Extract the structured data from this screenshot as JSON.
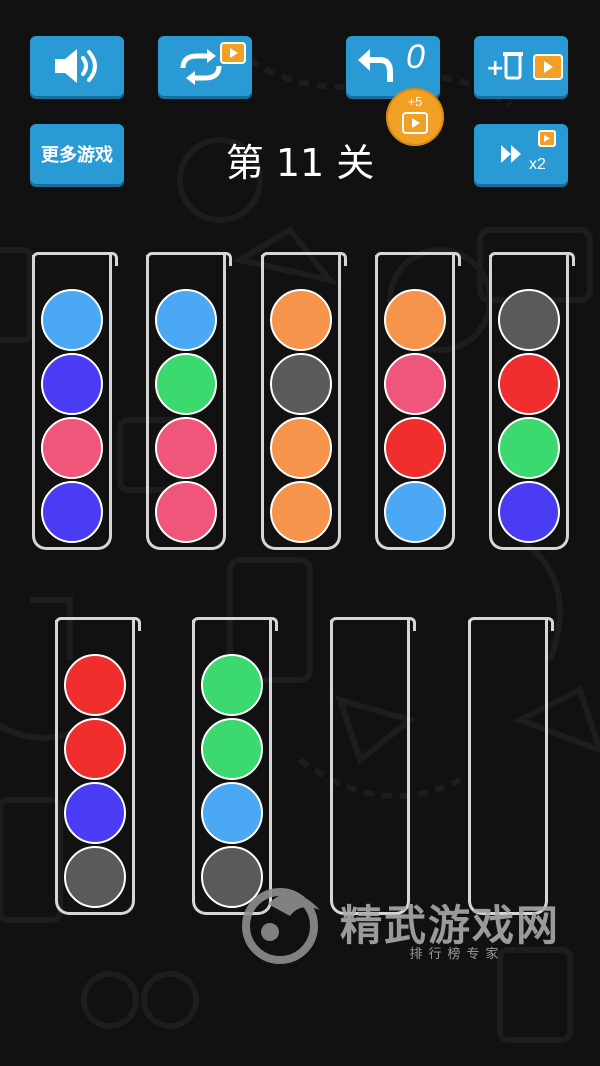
{
  "header": {
    "level_title": "第 11 关",
    "more_games_label": "更多游戏",
    "undo_count": "0",
    "undo_bonus": "+5"
  },
  "buttons": {
    "sound_icon": "speaker-icon",
    "restart_icon": "restart-icon",
    "undo_icon": "undo-icon",
    "add_tube_icon": "add-tube-icon",
    "skip_icon": "fast-forward-icon",
    "skip_label": "x2"
  },
  "colors": {
    "light_blue": "#4aa8f5",
    "blue": "#4a3cf5",
    "pink": "#f0557a",
    "green": "#3cd96e",
    "orange": "#f5944a",
    "gray": "#5a5a5a",
    "red": "#f02e2e",
    "button": "#2a9ad4",
    "badge": "#f2a025"
  },
  "tubes": [
    {
      "balls": [
        "light_blue",
        "blue",
        "pink",
        "blue"
      ]
    },
    {
      "balls": [
        "light_blue",
        "green",
        "pink",
        "pink"
      ]
    },
    {
      "balls": [
        "orange",
        "gray",
        "orange",
        "orange"
      ]
    },
    {
      "balls": [
        "orange",
        "pink",
        "red",
        "light_blue"
      ]
    },
    {
      "balls": [
        "gray",
        "red",
        "green",
        "blue"
      ]
    },
    {
      "balls": [
        "red",
        "red",
        "blue",
        "gray"
      ]
    },
    {
      "balls": [
        "green",
        "green",
        "light_blue",
        "gray"
      ]
    },
    {
      "balls": []
    },
    {
      "balls": []
    }
  ],
  "watermark": {
    "title": "精武游戏网",
    "subtitle": "排行榜专家"
  }
}
